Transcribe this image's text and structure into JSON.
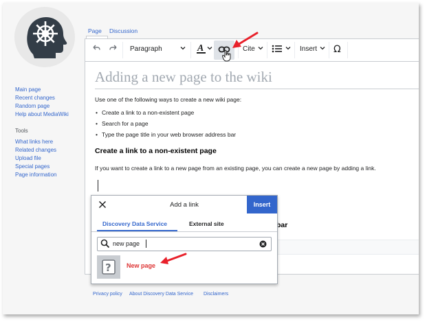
{
  "sidebar": {
    "nav": [
      "Main page",
      "Recent changes",
      "Random page",
      "Help about MediaWiki"
    ],
    "tools_heading": "Tools",
    "tools": [
      "What links here",
      "Related changes",
      "Upload file",
      "Special pages",
      "Page information"
    ]
  },
  "tabs": [
    "Page",
    "Discussion"
  ],
  "toolbar": {
    "paragraph": "Paragraph",
    "cite": "Cite",
    "insert": "Insert"
  },
  "page": {
    "title": "Adding a new page to the wiki",
    "intro": "Use one of the following ways to create a new wiki page:",
    "bullets": [
      "Create a link to a non-existent page",
      "Search for a page",
      "Type the page title in your web browser address bar"
    ],
    "heading": "Create a link to a non-existent page",
    "paragraph": "If you want to create a link to a new page from an existing page, you can create a new page by adding a link.",
    "partial_heading": "bar"
  },
  "dialog": {
    "title": "Add a link",
    "insert_label": "Insert",
    "tabs": [
      "Discovery Data Service",
      "External site"
    ],
    "search_value": "new page",
    "result_label": "New page"
  },
  "footer": [
    "Privacy policy",
    "About Discovery Data Service",
    "Disclaimers"
  ],
  "colors": {
    "accent": "#3366cc",
    "annotation_arrow": "#e8202a",
    "new_page_red": "#dd3333"
  }
}
